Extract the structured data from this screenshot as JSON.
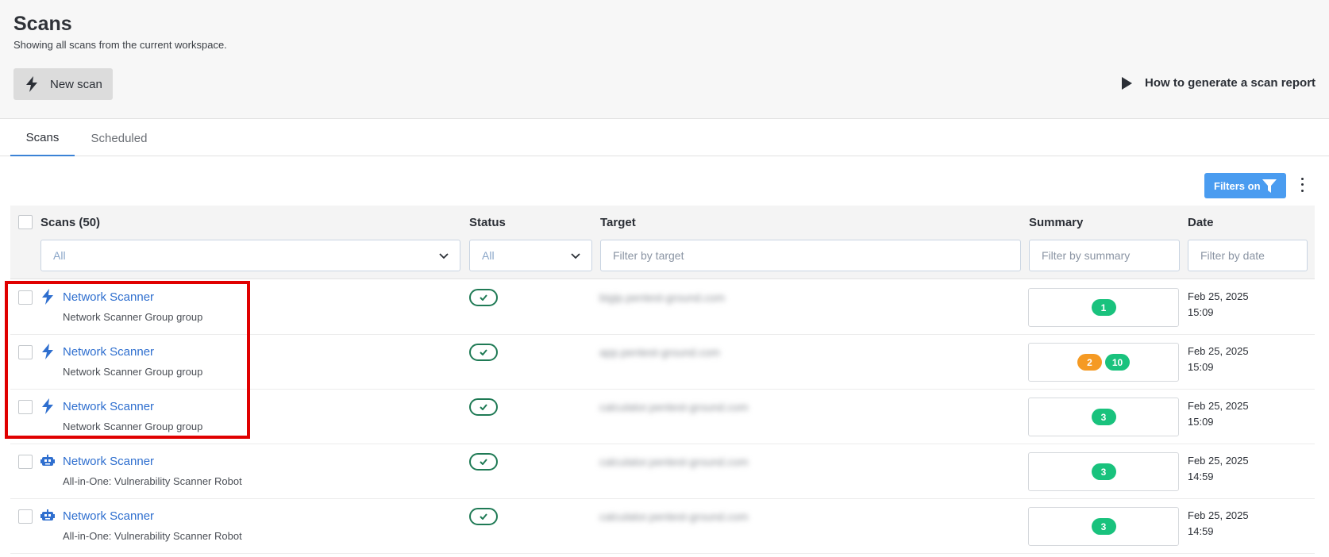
{
  "header": {
    "title": "Scans",
    "subtitle": "Showing all scans from the current workspace.",
    "new_scan_label": "New scan",
    "howto_label": "How to generate a scan report"
  },
  "tabs": [
    {
      "label": "Scans",
      "active": true
    },
    {
      "label": "Scheduled",
      "active": false
    }
  ],
  "toolbar": {
    "filters_label": "Filters on"
  },
  "table": {
    "columns": {
      "scans": "Scans (50)",
      "status": "Status",
      "target": "Target",
      "summary": "Summary",
      "date": "Date"
    },
    "filters": {
      "scans_select": "All",
      "status_select": "All",
      "target_placeholder": "Filter by target",
      "summary_placeholder": "Filter by summary",
      "date_placeholder": "Filter by date"
    },
    "rows": [
      {
        "name": "Network Scanner",
        "group": "Network Scanner Group group",
        "icon": "lightning-icon",
        "target": "bigip.pentest-ground.com",
        "date": "Feb 25, 2025",
        "time": "15:09",
        "badges": [
          {
            "value": "1",
            "color": "#19c27d"
          }
        ]
      },
      {
        "name": "Network Scanner",
        "group": "Network Scanner Group group",
        "icon": "lightning-icon",
        "target": "app.pentest-ground.com",
        "date": "Feb 25, 2025",
        "time": "15:09",
        "badges": [
          {
            "value": "2",
            "color": "#f59a23"
          },
          {
            "value": "10",
            "color": "#19c27d"
          }
        ]
      },
      {
        "name": "Network Scanner",
        "group": "Network Scanner Group group",
        "icon": "lightning-icon",
        "target": "calculator.pentest-ground.com",
        "date": "Feb 25, 2025",
        "time": "15:09",
        "badges": [
          {
            "value": "3",
            "color": "#19c27d"
          }
        ]
      },
      {
        "name": "Network Scanner",
        "group": "All-in-One: Vulnerability Scanner Robot",
        "icon": "robot-icon",
        "target": "calculator.pentest-ground.com",
        "date": "Feb 25, 2025",
        "time": "14:59",
        "badges": [
          {
            "value": "3",
            "color": "#19c27d"
          }
        ]
      },
      {
        "name": "Network Scanner",
        "group": "All-in-One: Vulnerability Scanner Robot",
        "icon": "robot-icon",
        "target": "calculator.pentest-ground.com",
        "date": "Feb 25, 2025",
        "time": "14:59",
        "badges": [
          {
            "value": "3",
            "color": "#19c27d"
          }
        ]
      }
    ]
  },
  "colors": {
    "accent": "#2f6fcf",
    "filters_button": "#4a9cf0",
    "status_ok": "#1f7a55",
    "badge_green": "#19c27d",
    "badge_orange": "#f59a23",
    "highlight": "#e00000"
  }
}
